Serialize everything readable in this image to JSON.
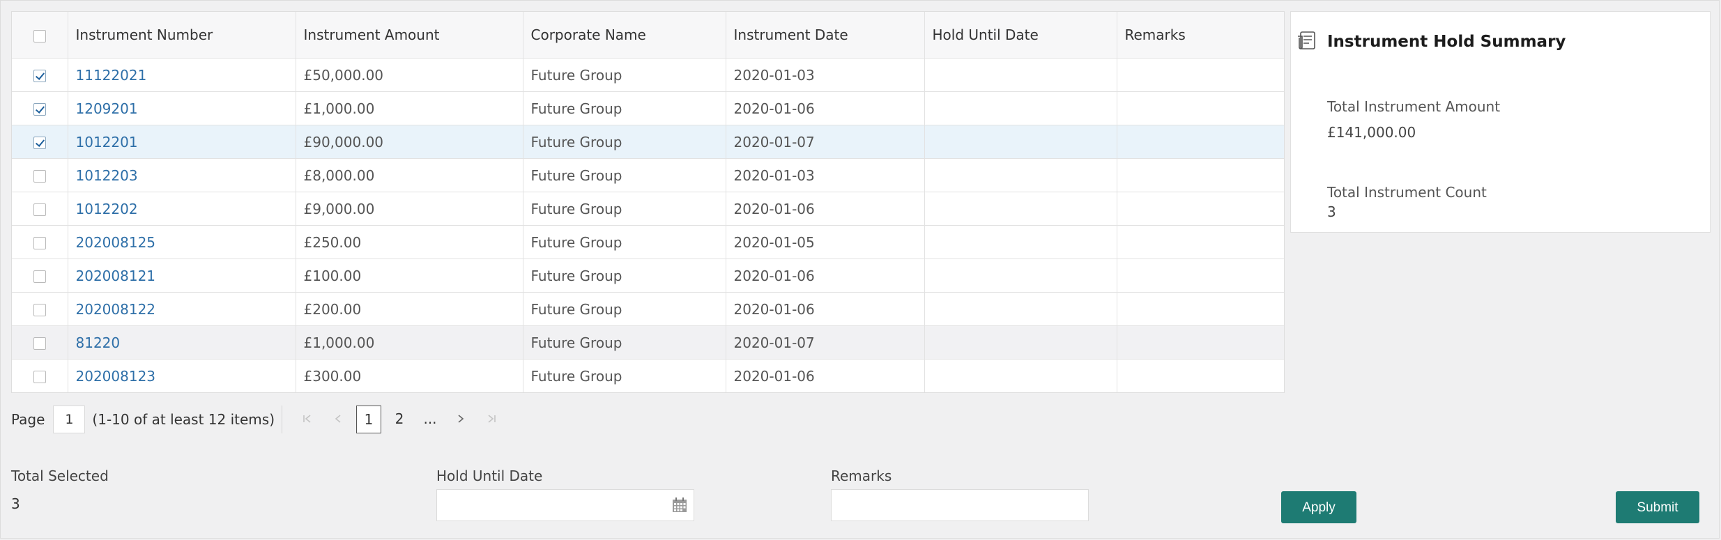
{
  "table": {
    "headers": [
      "Instrument Number",
      "Instrument Amount",
      "Corporate Name",
      "Instrument Date",
      "Hold Until Date",
      "Remarks"
    ],
    "rows": [
      {
        "checked": true,
        "number": "11122021",
        "amount": "£50,000.00",
        "corporate": "Future Group",
        "date": "2020-01-03",
        "hold": "",
        "remarks": ""
      },
      {
        "checked": true,
        "number": "1209201",
        "amount": "£1,000.00",
        "corporate": "Future Group",
        "date": "2020-01-06",
        "hold": "",
        "remarks": ""
      },
      {
        "checked": true,
        "number": "1012201",
        "amount": "£90,000.00",
        "corporate": "Future Group",
        "date": "2020-01-07",
        "hold": "",
        "remarks": ""
      },
      {
        "checked": false,
        "number": "1012203",
        "amount": "£8,000.00",
        "corporate": "Future Group",
        "date": "2020-01-03",
        "hold": "",
        "remarks": ""
      },
      {
        "checked": false,
        "number": "1012202",
        "amount": "£9,000.00",
        "corporate": "Future Group",
        "date": "2020-01-06",
        "hold": "",
        "remarks": ""
      },
      {
        "checked": false,
        "number": "202008125",
        "amount": "£250.00",
        "corporate": "Future Group",
        "date": "2020-01-05",
        "hold": "",
        "remarks": ""
      },
      {
        "checked": false,
        "number": "202008121",
        "amount": "£100.00",
        "corporate": "Future Group",
        "date": "2020-01-06",
        "hold": "",
        "remarks": ""
      },
      {
        "checked": false,
        "number": "202008122",
        "amount": "£200.00",
        "corporate": "Future Group",
        "date": "2020-01-06",
        "hold": "",
        "remarks": ""
      },
      {
        "checked": false,
        "number": "81220",
        "amount": "£1,000.00",
        "corporate": "Future Group",
        "date": "2020-01-07",
        "hold": "",
        "remarks": ""
      },
      {
        "checked": false,
        "number": "202008123",
        "amount": "£300.00",
        "corporate": "Future Group",
        "date": "2020-01-06",
        "hold": "",
        "remarks": ""
      }
    ]
  },
  "pagination": {
    "page_label": "Page",
    "page_value": "1",
    "range_text": "(1-10 of at least 12 items)",
    "pages": [
      "1",
      "2"
    ],
    "ellipsis": "..."
  },
  "summary": {
    "title": "Instrument Hold Summary",
    "total_amount_label": "Total Instrument Amount",
    "total_amount_value": "£141,000.00",
    "total_count_label": "Total Instrument Count",
    "total_count_value": "3"
  },
  "form": {
    "total_selected_label": "Total Selected",
    "total_selected_value": "3",
    "hold_until_label": "Hold Until Date",
    "hold_until_value": "",
    "remarks_label": "Remarks",
    "remarks_value": "",
    "apply_label": "Apply",
    "submit_label": "Submit"
  },
  "colors": {
    "accent": "#1e7b73",
    "link": "#2e6fa8",
    "selected_row": "#e9f3fa",
    "page_bg": "#f0f0f1"
  },
  "icons": {
    "summary": "document-list-icon",
    "date_picker": "calendar-icon",
    "first_page": "first-page-icon",
    "prev_page": "prev-page-icon",
    "next_page": "next-page-icon",
    "last_page": "last-page-icon"
  }
}
